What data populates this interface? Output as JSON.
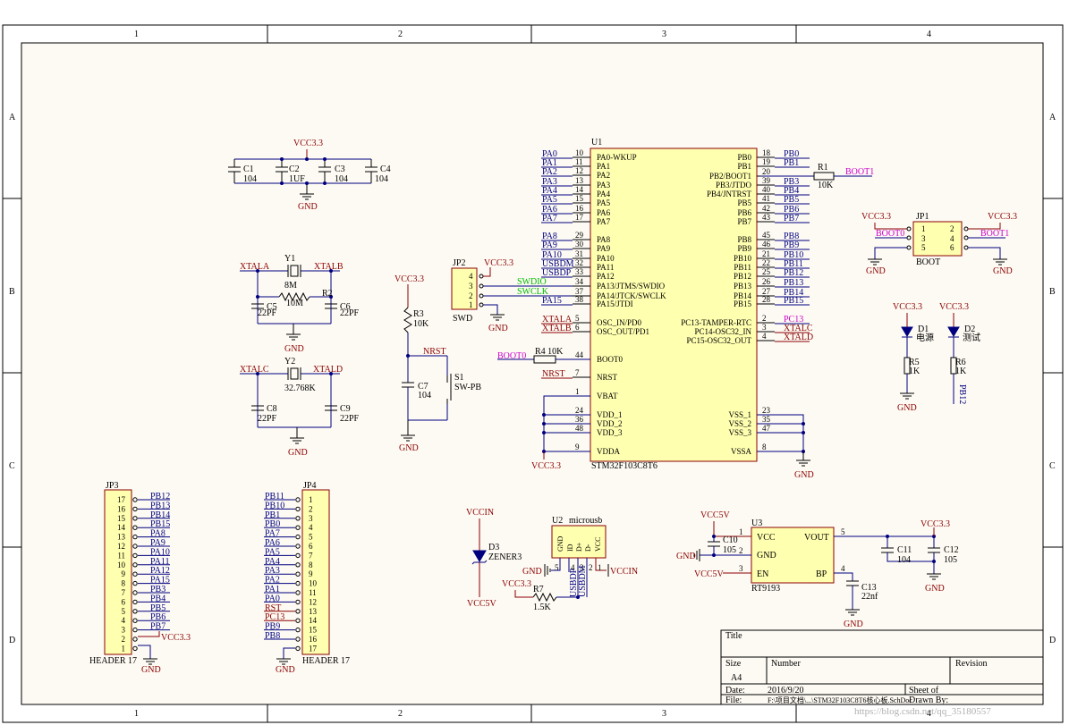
{
  "frame": {
    "columns": [
      "1",
      "2",
      "3",
      "4"
    ],
    "rows": [
      "A",
      "B",
      "C",
      "D"
    ]
  },
  "titleblock": {
    "title_label": "Title",
    "size_label": "Size",
    "size_value": "A4",
    "number_label": "Number",
    "revision_label": "Revision",
    "date_label": "Date:",
    "date_value": "2016/9/20",
    "file_label": "File:",
    "file_value": "F:\\项目文档\\...\\STM32F103C8T6核心板.SchDoc",
    "sheet_label": "Sheet    of",
    "drawn_label": "Drawn By:",
    "watermark": "https://blog.csdn.net/qq_35180557"
  },
  "caps_block": {
    "net": "VCC3.3",
    "gnd": "GND",
    "parts": [
      {
        "ref": "C1",
        "value": "104"
      },
      {
        "ref": "C2",
        "value": "1UF"
      },
      {
        "ref": "C3",
        "value": "104"
      },
      {
        "ref": "C4",
        "value": "104"
      }
    ]
  },
  "osc_main": {
    "xtal_ref": "Y1",
    "xtal_val": "8M",
    "res_ref": "R2",
    "res_val": "10M",
    "c_left_ref": "C5",
    "c_left_val": "22PF",
    "c_right_ref": "C6",
    "c_right_val": "22PF",
    "net_left": "XTALA",
    "net_right": "XTALB",
    "gnd": "GND"
  },
  "osc_rtc": {
    "xtal_ref": "Y2",
    "xtal_val": "32.768K",
    "c_left_ref": "C8",
    "c_left_val": "22PF",
    "c_right_ref": "C9",
    "c_right_val": "22PF",
    "net_left": "XTALC",
    "net_right": "XTALD",
    "gnd": "GND"
  },
  "reset": {
    "vcc": "VCC3.3",
    "r_ref": "R3",
    "r_val": "10K",
    "net": "NRST",
    "c_ref": "C7",
    "c_val": "104",
    "sw_ref": "S1",
    "sw_val": "SW-PB",
    "gnd": "GND"
  },
  "swd": {
    "ref": "JP2",
    "name": "SWD",
    "vcc": "VCC3.3",
    "gnd": "GND",
    "pins": [
      "4",
      "3",
      "2",
      "1"
    ],
    "net_dio": "SWDIO",
    "net_clk": "SWCLK"
  },
  "mcu": {
    "ref": "U1",
    "part": "STM32F103C8T6",
    "left_pins": [
      {
        "net": "PA0",
        "num": "10",
        "name": "PA0-WKUP"
      },
      {
        "net": "PA1",
        "num": "11",
        "name": "PA1"
      },
      {
        "net": "PA2",
        "num": "12",
        "name": "PA2"
      },
      {
        "net": "PA3",
        "num": "13",
        "name": "PA3"
      },
      {
        "net": "PA4",
        "num": "14",
        "name": "PA4"
      },
      {
        "net": "PA5",
        "num": "15",
        "name": "PA5"
      },
      {
        "net": "PA6",
        "num": "16",
        "name": "PA6"
      },
      {
        "net": "PA7",
        "num": "17",
        "name": "PA7"
      },
      {
        "net": "PA8",
        "num": "29",
        "name": "PA8"
      },
      {
        "net": "PA9",
        "num": "30",
        "name": "PA9"
      },
      {
        "net": "PA10",
        "num": "31",
        "name": "PA10"
      },
      {
        "net": "USBDM",
        "num": "32",
        "name": "PA11"
      },
      {
        "net": "USBDP",
        "num": "33",
        "name": "PA12"
      },
      {
        "net": "",
        "num": "34",
        "name": "PA13/JTMS/SWDIO"
      },
      {
        "net": "",
        "num": "37",
        "name": "PA14/JTCK/SWCLK"
      },
      {
        "net": "PA15",
        "num": "38",
        "name": "PA15/JTDI"
      },
      {
        "net": "XTALA",
        "num": "5",
        "name": "OSC_IN/PD0"
      },
      {
        "net": "XTALB",
        "num": "6",
        "name": "OSC_OUT/PD1"
      },
      {
        "net": "",
        "num": "44",
        "name": "BOOT0"
      },
      {
        "net": "NRST",
        "num": "7",
        "name": "NRST"
      },
      {
        "net": "",
        "num": "1",
        "name": "VBAT"
      },
      {
        "net": "",
        "num": "24",
        "name": "VDD_1"
      },
      {
        "net": "",
        "num": "36",
        "name": "VDD_2"
      },
      {
        "net": "",
        "num": "48",
        "name": "VDD_3"
      },
      {
        "net": "",
        "num": "9",
        "name": "VDDA"
      }
    ],
    "right_pins": [
      {
        "net": "PB0",
        "num": "18",
        "name": "PB0"
      },
      {
        "net": "PB1",
        "num": "19",
        "name": "PB1"
      },
      {
        "net": "",
        "num": "20",
        "name": "PB2/BOOT1"
      },
      {
        "net": "PB3",
        "num": "39",
        "name": "PB3/JTDO"
      },
      {
        "net": "PB4",
        "num": "40",
        "name": "PB4/JNTRST"
      },
      {
        "net": "PB5",
        "num": "41",
        "name": "PB5"
      },
      {
        "net": "PB6",
        "num": "42",
        "name": "PB6"
      },
      {
        "net": "PB7",
        "num": "43",
        "name": "PB7"
      },
      {
        "net": "PB8",
        "num": "45",
        "name": "PB8"
      },
      {
        "net": "PB9",
        "num": "46",
        "name": "PB9"
      },
      {
        "net": "PB10",
        "num": "21",
        "name": "PB10"
      },
      {
        "net": "PB11",
        "num": "22",
        "name": "PB11"
      },
      {
        "net": "PB12",
        "num": "25",
        "name": "PB12"
      },
      {
        "net": "PB13",
        "num": "26",
        "name": "PB13"
      },
      {
        "net": "PB14",
        "num": "27",
        "name": "PB14"
      },
      {
        "net": "PB15",
        "num": "28",
        "name": "PB15"
      },
      {
        "net": "PC13",
        "num": "2",
        "name": "PC13-TAMPER-RTC"
      },
      {
        "net": "XTALC",
        "num": "3",
        "name": "PC14-OSC32_IN"
      },
      {
        "net": "XTALD",
        "num": "4",
        "name": "PC15-OSC32_OUT"
      },
      {
        "net": "",
        "num": "23",
        "name": "VSS_1"
      },
      {
        "net": "",
        "num": "35",
        "name": "VSS_2"
      },
      {
        "net": "",
        "num": "47",
        "name": "VSS_3"
      },
      {
        "net": "",
        "num": "8",
        "name": "VSSA"
      }
    ],
    "r1_ref": "R1",
    "r1_val": "10K",
    "r1_net": "BOOT1",
    "r4_label": "R4 10K",
    "r4_net": "BOOT0",
    "vcc": "VCC3.3",
    "gnd": "GND"
  },
  "boot_header": {
    "ref": "JP1",
    "name": "BOOT",
    "vcc_left": "VCC3.3",
    "vcc_right": "VCC3.3",
    "net_left": "BOOT0",
    "net_right": "BOOT1",
    "pins_left": [
      "1",
      "3",
      "5"
    ],
    "pins_right": [
      "2",
      "4",
      "6"
    ],
    "gnd": "GND"
  },
  "leds": {
    "vcc": "VCC3.3",
    "d1_ref": "D1",
    "d1_label": "电源",
    "r5_ref": "R5",
    "r5_val": "1K",
    "gnd": "GND",
    "d2_ref": "D2",
    "d2_label": "测试",
    "r6_ref": "R6",
    "r6_val": "1K",
    "net": "PB12"
  },
  "jp3": {
    "ref": "JP3",
    "name": "HEADER 17",
    "gnd": "GND",
    "vcc": "VCC3.3",
    "pins": [
      "17",
      "16",
      "15",
      "14",
      "13",
      "12",
      "11",
      "10",
      "9",
      "8",
      "7",
      "6",
      "5",
      "4",
      "3",
      "2",
      "1"
    ],
    "nets": [
      "PB12",
      "PB13",
      "PB14",
      "PB15",
      "PA8",
      "PA9",
      "PA10",
      "PA11",
      "PA12",
      "PA15",
      "PB3",
      "PB4",
      "PB5",
      "PB6",
      "PB7"
    ]
  },
  "jp4": {
    "ref": "JP4",
    "name": "HEADER 17",
    "gnd": "GND",
    "pins": [
      "1",
      "2",
      "3",
      "4",
      "5",
      "6",
      "7",
      "8",
      "9",
      "10",
      "11",
      "12",
      "13",
      "14",
      "15",
      "16",
      "17"
    ],
    "nets": [
      "PB11",
      "PB10",
      "PB1",
      "PB0",
      "PA7",
      "PA6",
      "PA5",
      "PA4",
      "PA3",
      "PA2",
      "PA1",
      "PA0",
      "RST",
      "PC13",
      "PB9",
      "PB8"
    ]
  },
  "zener": {
    "top": "VCCIN",
    "ref": "D3",
    "val": "ZENER3",
    "bottom": "VCC5V"
  },
  "usb": {
    "ref": "U2",
    "name": "microusb",
    "pins_text": [
      "GND",
      "ID",
      "D+",
      "D-",
      "VCC"
    ],
    "pin_nums": [
      "5",
      "4",
      "3",
      "2",
      "1"
    ],
    "gnd": "GND",
    "vccin": "VCCIN",
    "vcc": "VCC3.3",
    "r_ref": "R7",
    "r_val": "1.5K",
    "net_dp": "USBDP",
    "net_dm": "USBDM"
  },
  "ldo": {
    "ref": "U3",
    "part": "RT9193",
    "vcc_in": "VCC5V",
    "vin_label": "VCC5V",
    "pin_vcc": "VCC",
    "pin_gnd": "GND",
    "pin_en": "EN",
    "pin_vout": "VOUT",
    "pin_bp": "BP",
    "pin_nums": [
      "1",
      "2",
      "3",
      "5",
      "4"
    ],
    "c10_ref": "C10",
    "c10_val": "105",
    "c11_ref": "C11",
    "c11_val": "104",
    "c12_ref": "C12",
    "c12_val": "105",
    "c13_ref": "C13",
    "c13_val": "22nf",
    "vcc_out": "VCC3.3",
    "gnd": "GND"
  }
}
